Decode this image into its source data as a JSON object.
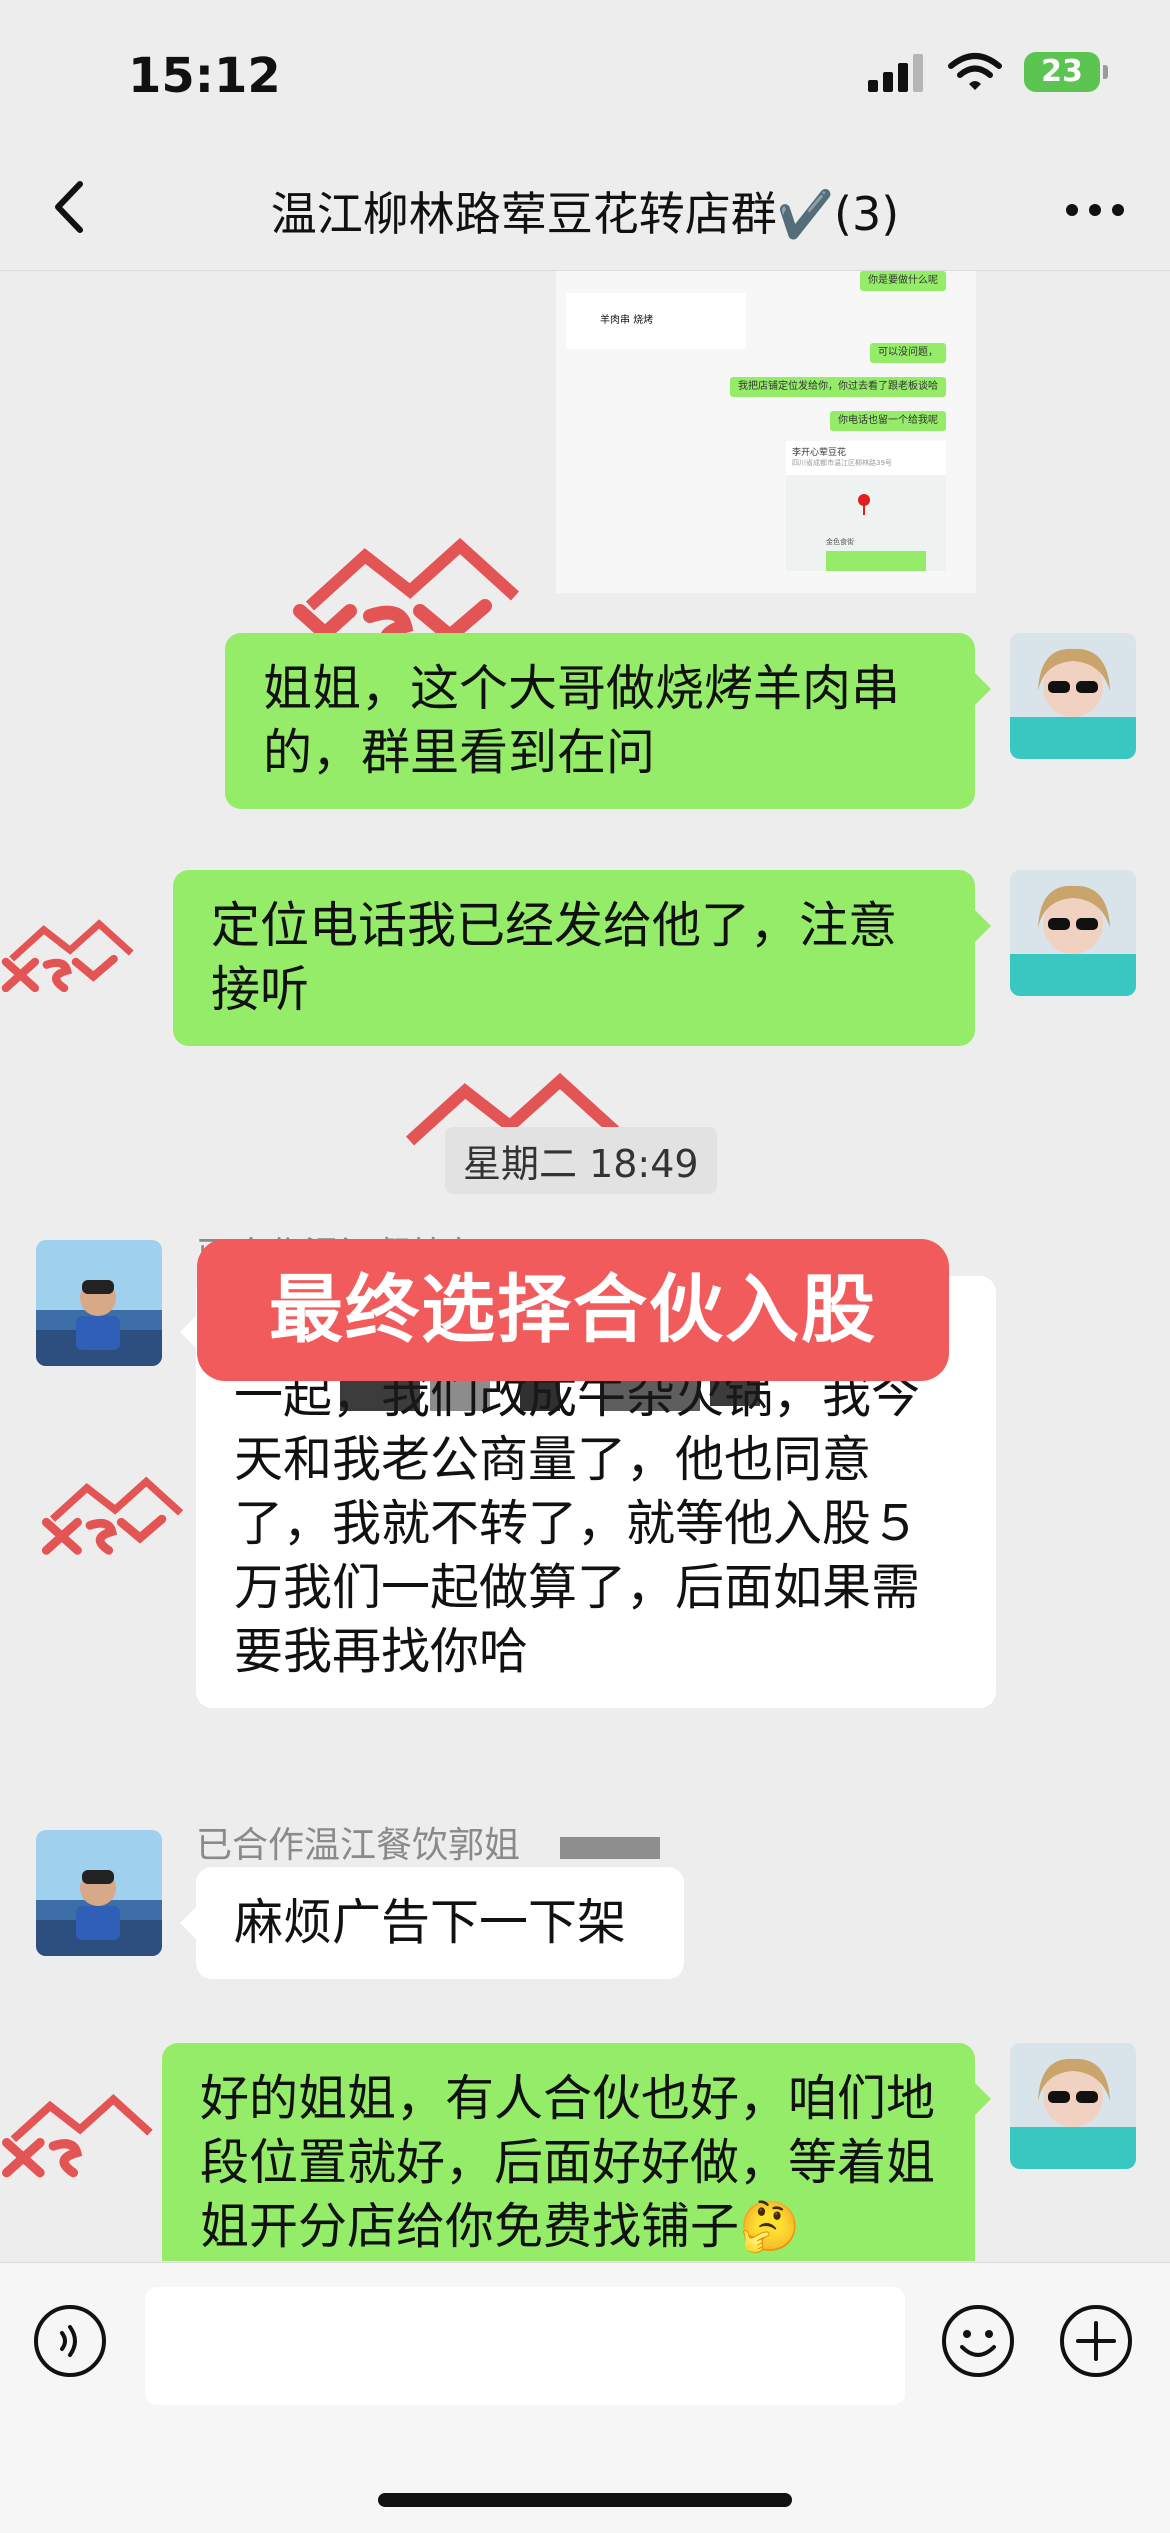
{
  "status_bar": {
    "time": "15:12",
    "battery": "23"
  },
  "nav": {
    "title": "温江柳林路荤豆花转店群✔️(3)"
  },
  "shared_screenshot": {
    "msg1": "你是要做什么呢",
    "card_text": "羊肉串   烧烤",
    "msg2": "可以没问题，",
    "msg3": "我把店铺定位发给你，你过去看了跟老板谈哈",
    "msg4": "你电话也留一个给我呢",
    "map_title": "李开心荤豆花",
    "map_addr": "四川省成都市温江区柳林路39号",
    "map_poi": "金色食街"
  },
  "messages": [
    {
      "text": "姐姐，这个大哥做烧烤羊肉串的，群里看到在问"
    },
    {
      "text": "定位电话我已经发给他了，注意接听"
    },
    {
      "sender": "已合作温江餐饮郭",
      "text": "姐姐…了他…然后入股５万和我一起，我们改成牛杂火锅，我今天和我老公商量了，他也同意了，我就不转了，就等他入股５万我们一起做算了，后面如果需要我再找你哈"
    },
    {
      "sender": "已合作温江餐饮郭姐",
      "text": "麻烦广告下一下架"
    },
    {
      "text": "好的姐姐，有人合伙也好，咱们地段位置就好，后面好好做，等着姐姐开分店给你免费找铺子🤔"
    }
  ],
  "timestamp": "星期二 18:49",
  "overlay_caption": "最终选择合伙入股",
  "colors": {
    "my_bubble": "#95ec69",
    "other_bubble": "#ffffff",
    "overlay": "#f15b5b",
    "chat_bg": "#ededed"
  }
}
